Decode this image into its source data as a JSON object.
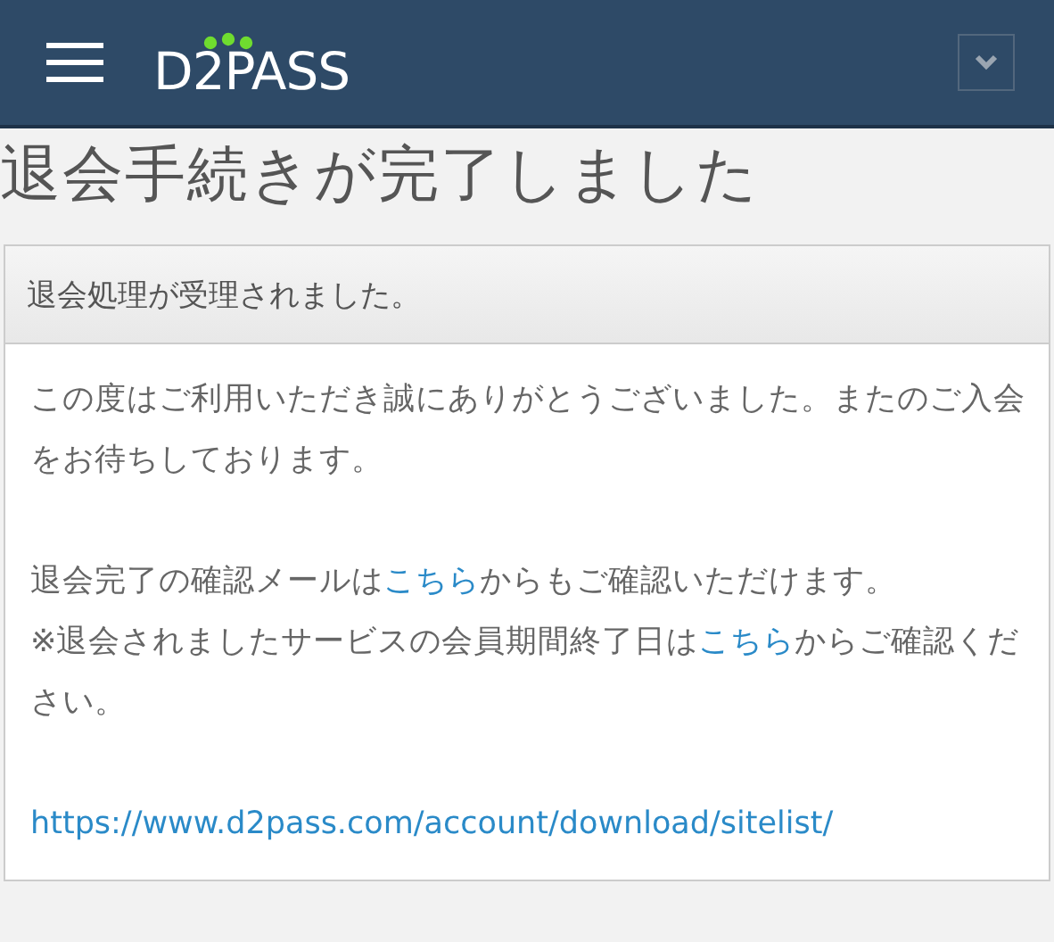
{
  "header": {
    "logo": "D2PASS"
  },
  "page_title": "退会手続きが完了しました",
  "panel": {
    "heading": "退会処理が受理されました。",
    "paragraphs": [
      [
        [
          {
            "kind": "text",
            "text": "この度はご利用いただき誠にありがとうございました。またのご入会をお待ちしております。"
          }
        ]
      ],
      [
        [
          {
            "kind": "text",
            "text": "退会完了の確認メールは"
          },
          {
            "kind": "link",
            "text": "こちら"
          },
          {
            "kind": "text",
            "text": "からもご確認いただけます。"
          }
        ],
        [
          {
            "kind": "text",
            "text": "※退会されましたサービスの会員期間終了日は"
          },
          {
            "kind": "link",
            "text": "こちら"
          },
          {
            "kind": "text",
            "text": "からご確認ください。"
          }
        ]
      ],
      [
        [
          {
            "kind": "link",
            "text": "https://www.d2pass.com/account/download/sitelist/"
          }
        ]
      ]
    ]
  }
}
